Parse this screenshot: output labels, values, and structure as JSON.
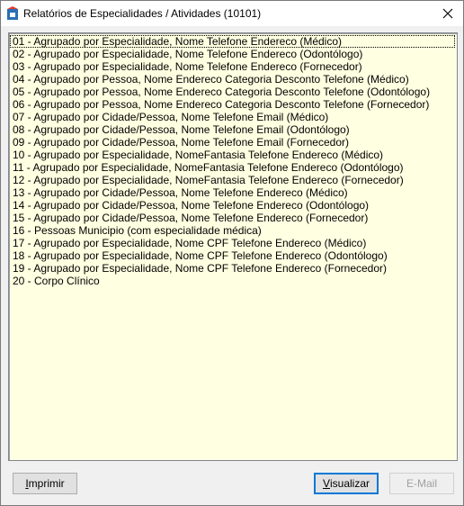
{
  "window": {
    "title": "Relatórios de Especialidades / Atividades (10101)"
  },
  "list": {
    "items": [
      "01 - Agrupado por Especialidade, Nome Telefone Endereco (Médico)",
      "02 - Agrupado por Especialidade, Nome Telefone Endereco (Odontólogo)",
      "03 - Agrupado por Especialidade, Nome Telefone Endereco (Fornecedor)",
      "04 - Agrupado por Pessoa, Nome Endereco Categoria Desconto Telefone (Médico)",
      "05 - Agrupado por Pessoa, Nome Endereco Categoria Desconto Telefone (Odontólogo)",
      "06 - Agrupado por Pessoa, Nome Endereco Categoria Desconto Telefone (Fornecedor)",
      "07 - Agrupado por Cidade/Pessoa, Nome Telefone Email (Médico)",
      "08 - Agrupado por Cidade/Pessoa, Nome Telefone Email (Odontólogo)",
      "09 - Agrupado por Cidade/Pessoa, Nome Telefone Email (Fornecedor)",
      "10 - Agrupado por Especialidade, NomeFantasia Telefone Endereco (Médico)",
      "11 - Agrupado por Especialidade, NomeFantasia Telefone Endereco (Odontólogo)",
      "12 - Agrupado por Especialidade, NomeFantasia Telefone Endereco (Fornecedor)",
      "13 - Agrupado por Cidade/Pessoa, Nome Telefone Endereco (Médico)",
      "14 - Agrupado por Cidade/Pessoa, Nome Telefone Endereco (Odontólogo)",
      "15 - Agrupado por Cidade/Pessoa, Nome Telefone Endereco (Fornecedor)",
      "16 - Pessoas Municipio (com especialidade médica)",
      "17 - Agrupado por Especialidade, Nome CPF Telefone Endereco (Médico)",
      "18 - Agrupado por Especialidade, Nome CPF Telefone Endereco (Odontólogo)",
      "19 - Agrupado por Especialidade, Nome CPF Telefone Endereco (Fornecedor)",
      "20 - Corpo Clínico"
    ]
  },
  "buttons": {
    "imprimir": {
      "accel": "I",
      "rest": "mprimir"
    },
    "visualizar": {
      "accel": "V",
      "rest": "isualizar"
    },
    "email": "E-Mail"
  },
  "colors": {
    "list_background": "#ffffe1",
    "window_background": "#f0f0f0"
  }
}
